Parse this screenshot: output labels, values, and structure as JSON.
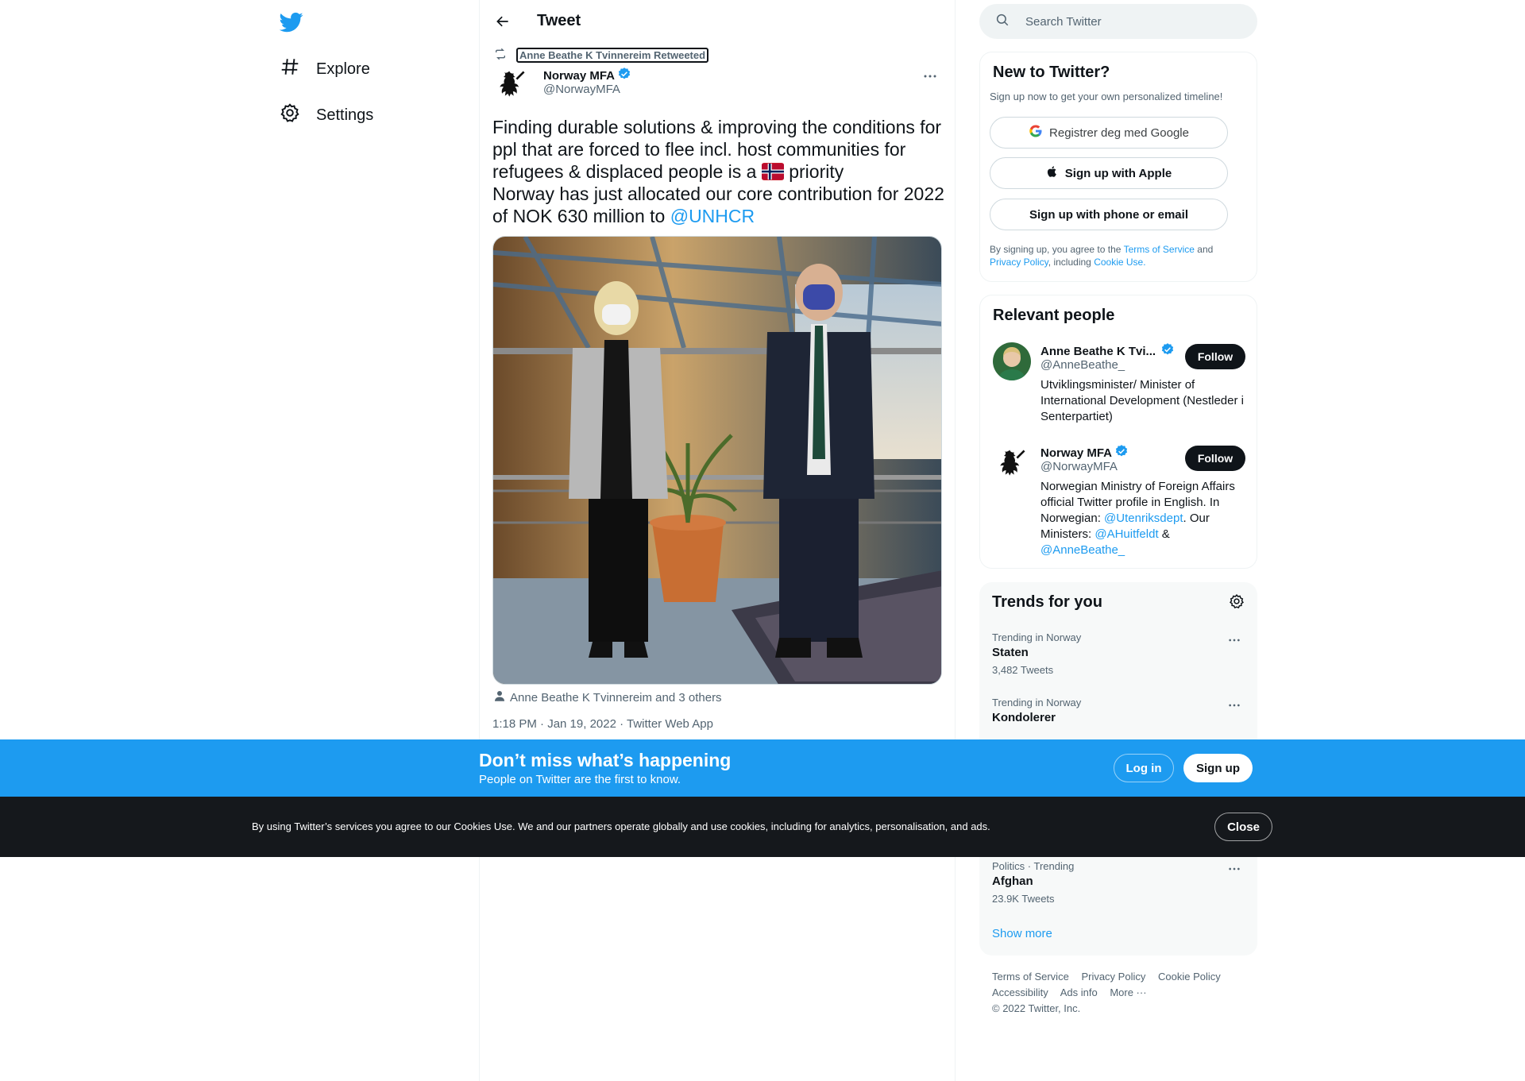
{
  "nav": {
    "items": [
      {
        "label": "Explore",
        "icon": "hashtag-icon"
      },
      {
        "label": "Settings",
        "icon": "gear-icon"
      }
    ]
  },
  "header": {
    "title": "Tweet"
  },
  "tweet": {
    "retweeted_by": "Anne Beathe K Tvinnereim Retweeted",
    "author_name": "Norway MFA",
    "author_handle": "@NorwayMFA",
    "text_part1": "Finding durable solutions & improving the conditions for ppl that are forced to flee incl. host communities for refugees & displaced people is a",
    "text_flag": "flag-norway-emoji",
    "text_part2": "priority",
    "text_part3": "Norway has just allocated our core contribution for 2022 of NOK 630 million to",
    "mention": "@UNHCR",
    "tagged": "Anne Beathe K Tvinnereim and 3 others",
    "meta": "1:18 PM · Jan 19, 2022 · Twitter Web App"
  },
  "search": {
    "placeholder": "Search Twitter"
  },
  "new_to_twitter": {
    "title": "New to Twitter?",
    "subtitle": "Sign up now to get your own personalized timeline!",
    "google": "Registrer deg med Google",
    "apple": "Sign up with Apple",
    "phone": "Sign up with phone or email",
    "terms_prefix": "By signing up, you agree to the",
    "terms_link": "Terms of Service",
    "terms_and": "and",
    "privacy_link": "Privacy Policy",
    "terms_including": ", including",
    "cookie_link": "Cookie Use."
  },
  "relevant_people": {
    "title": "Relevant people",
    "people": [
      {
        "name": "Anne Beathe K Tvi...",
        "handle": "@AnneBeathe_",
        "follow": "Follow",
        "bio": "Utviklingsminister/ Minister of International Development (Nestleder i Senterpartiet)"
      },
      {
        "name": "Norway MFA",
        "handle": "@NorwayMFA",
        "follow": "Follow",
        "bio_part1": "Norwegian Ministry of Foreign Affairs official Twitter profile in English. In Norwegian:",
        "bio_link1": "@Utenriksdept",
        "bio_part2": ". Our Ministers:",
        "bio_link2": "@AHuitfeldt",
        "bio_part3": "&",
        "bio_link3": "@AnneBeathe_"
      }
    ]
  },
  "trends": {
    "title": "Trends for you",
    "items": [
      {
        "context": "Trending in Norway",
        "name": "Staten",
        "count": "3,482 Tweets"
      },
      {
        "context": "Trending in Norway",
        "name": "Kondolerer",
        "count": ""
      },
      {
        "context": "Politics · Trending",
        "name": "Afghan",
        "count": "23.9K Tweets"
      }
    ],
    "show_more": "Show more"
  },
  "footer": {
    "links": [
      "Terms of Service",
      "Privacy Policy",
      "Cookie Policy",
      "Accessibility",
      "Ads info",
      "More ···"
    ],
    "copyright": "© 2022 Twitter, Inc."
  },
  "login_bar": {
    "title": "Don’t miss what’s happening",
    "subtitle": "People on Twitter are the first to know.",
    "login": "Log in",
    "signup": "Sign up"
  },
  "cookie_bar": {
    "text": "By using Twitter’s services you agree to our Cookies Use. We and our partners operate globally and use cookies, including for analytics, personalisation, and ads.",
    "close": "Close"
  },
  "colors": {
    "accent": "#1d9bf0",
    "text": "#0f1419",
    "muted": "#536471",
    "cookie_bg": "#15181c"
  }
}
